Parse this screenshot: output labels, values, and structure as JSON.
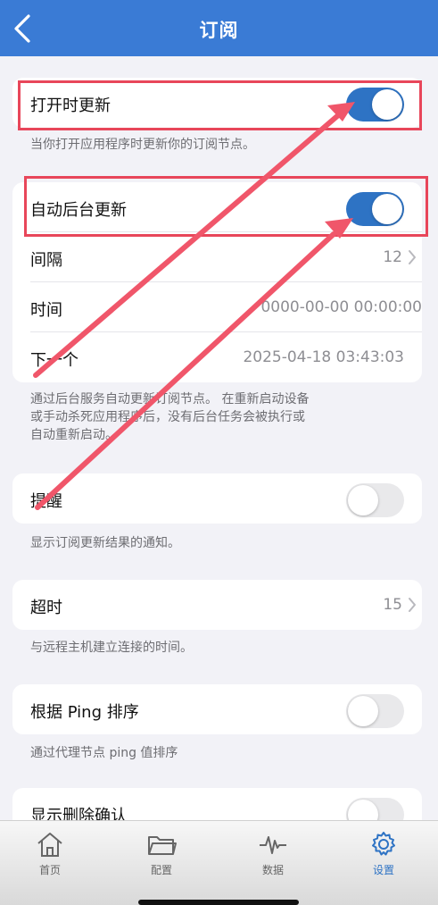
{
  "nav": {
    "title": "订阅"
  },
  "settings": {
    "update_on_open": {
      "label": "打开时更新",
      "on": true,
      "desc": "当你打开应用程序时更新你的订阅节点。"
    },
    "auto_update": {
      "label": "自动后台更新",
      "on": true,
      "interval_label": "间隔",
      "interval_value": "12",
      "time_label": "时间",
      "time_value": "0000-00-00 00:00:00",
      "next_label": "下一个",
      "next_value": "2025-04-18 03:43:03",
      "desc_line1": "通过后台服务自动更新订阅节点。 在重新启动设备",
      "desc_line2": "或手动杀死应用程序后，没有后台任务会被执行或",
      "desc_line3": "自动重新启动。"
    },
    "reminder": {
      "label": "提醒",
      "on": false,
      "desc": "显示订阅更新结果的通知。"
    },
    "timeout": {
      "label": "超时",
      "value": "15",
      "desc": "与远程主机建立连接的时间。"
    },
    "ping_sort": {
      "label": "根据 Ping 排序",
      "on": false,
      "desc": "通过代理节点 ping 值排序"
    },
    "delete_confirm": {
      "label": "显示删除确认",
      "on": false
    }
  },
  "tabbar": {
    "items": [
      {
        "label": "首页",
        "icon": "home-icon"
      },
      {
        "label": "配置",
        "icon": "folder-icon"
      },
      {
        "label": "数据",
        "icon": "pulse-icon"
      },
      {
        "label": "设置",
        "icon": "gear-icon"
      }
    ],
    "active_index": 3
  },
  "colors": {
    "nav": "#3a7bd5",
    "toggle_on": "#2e73c4",
    "annotation": "#f0566a"
  }
}
